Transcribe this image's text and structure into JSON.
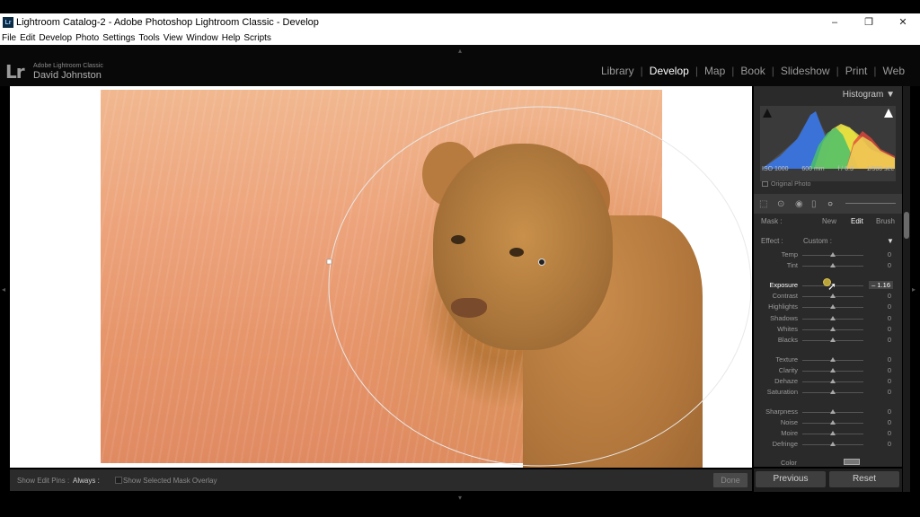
{
  "window": {
    "badge": "Lr",
    "title": "Lightroom Catalog-2 - Adobe Photoshop Lightroom Classic - Develop",
    "controls": [
      "–",
      "❐",
      "✕"
    ]
  },
  "menu": [
    "File",
    "Edit",
    "Develop",
    "Photo",
    "Settings",
    "Tools",
    "View",
    "Window",
    "Help",
    "Scripts"
  ],
  "identity": {
    "logo": "Lr",
    "product": "Adobe Lightroom Classic",
    "user": "David Johnston"
  },
  "modules": [
    "Library",
    "Develop",
    "Map",
    "Book",
    "Slideshow",
    "Print",
    "Web"
  ],
  "active_module": "Develop",
  "toolbar": {
    "show_pins_label": "Show Edit Pins :",
    "show_pins_value": "Always :",
    "overlay_label": "Show Selected Mask Overlay",
    "done": "Done"
  },
  "histogram": {
    "title": "Histogram ▼",
    "iso": "ISO 1000",
    "focal": "600 mm",
    "aperture": "f / 6.3",
    "shutter": "1/500 sec",
    "original_photo": "Original Photo"
  },
  "mask": {
    "label": "Mask :",
    "new": "New",
    "edit": "Edit",
    "brush": "Brush"
  },
  "effect": {
    "label": "Effect :",
    "value": "Custom :",
    "arrow": "▼"
  },
  "sliders": [
    {
      "label": "Temp",
      "value": "0",
      "pos": 0.5
    },
    {
      "label": "Tint",
      "value": "0",
      "pos": 0.5
    },
    {
      "label": "Exposure",
      "value": "– 1.16",
      "pos": 0.39
    },
    {
      "label": "Contrast",
      "value": "0",
      "pos": 0.5
    },
    {
      "label": "Highlights",
      "value": "0",
      "pos": 0.5
    },
    {
      "label": "Shadows",
      "value": "0",
      "pos": 0.5
    },
    {
      "label": "Whites",
      "value": "0",
      "pos": 0.5
    },
    {
      "label": "Blacks",
      "value": "0",
      "pos": 0.5
    },
    {
      "label": "Texture",
      "value": "0",
      "pos": 0.5
    },
    {
      "label": "Clarity",
      "value": "0",
      "pos": 0.5
    },
    {
      "label": "Dehaze",
      "value": "0",
      "pos": 0.5
    },
    {
      "label": "Saturation",
      "value": "0",
      "pos": 0.5
    },
    {
      "label": "Sharpness",
      "value": "0",
      "pos": 0.5
    },
    {
      "label": "Noise",
      "value": "0",
      "pos": 0.5
    },
    {
      "label": "Moire",
      "value": "0",
      "pos": 0.5
    },
    {
      "label": "Defringe",
      "value": "0",
      "pos": 0.5
    }
  ],
  "color_label": "Color",
  "buttons": {
    "previous": "Previous",
    "reset": "Reset"
  },
  "colors": {
    "accent_knob": "#b9a33a",
    "panel_bg": "#2a2a2a",
    "active_text": "#ffffff"
  }
}
